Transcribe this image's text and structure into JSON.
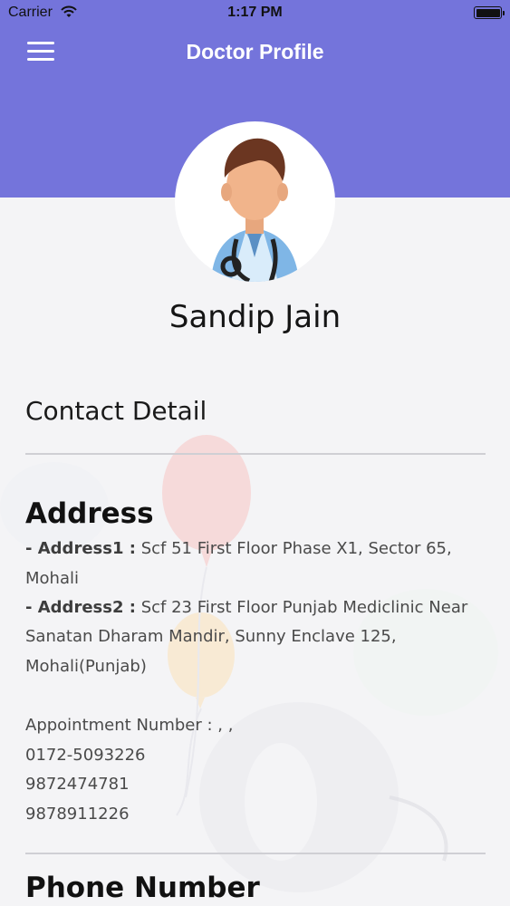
{
  "status_bar": {
    "carrier": "Carrier",
    "time": "1:17 PM"
  },
  "header": {
    "title": "Doctor Profile",
    "color": "#7474db"
  },
  "doctor": {
    "name": "Sandip Jain"
  },
  "contact": {
    "section_title": "Contact Detail",
    "address_heading": "Address",
    "address1_label": "- Address1 :",
    "address1_value": "Scf 51 First Floor Phase X1, Sector 65, Mohali",
    "address2_label": "- Address2 :",
    "address2_value_line1": "Scf 23 First Floor Punjab Mediclinic Near",
    "address2_value_line2": "Sanatan Dharam Mandir, Sunny Enclave 125,",
    "address2_value_line3": "Mohali(Punjab)",
    "appointment_label": "Appointment Number : , ,",
    "phones": [
      "0172-5093226",
      "9872474781",
      "9878911226"
    ],
    "phone_heading": "Phone Number"
  },
  "icons": {
    "menu": "hamburger-menu-icon",
    "wifi": "wifi-icon",
    "battery": "battery-icon",
    "avatar": "doctor-avatar-icon"
  }
}
